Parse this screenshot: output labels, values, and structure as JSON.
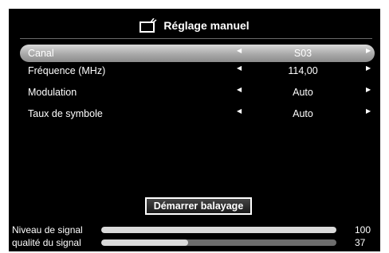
{
  "header": {
    "title": "Réglage manuel",
    "icon": "tv-antenna-icon"
  },
  "rows": [
    {
      "label": "Canal",
      "value": "S03",
      "selected": true
    },
    {
      "label": "Fréquence (MHz)",
      "value": "114,00"
    },
    {
      "label": "Modulation",
      "value": "Auto"
    },
    {
      "label": "Taux de symbole",
      "value": "Auto"
    }
  ],
  "arrows": {
    "left": "◀",
    "right": "▶"
  },
  "scan_button": {
    "label": "Démarrer balayage"
  },
  "meters": [
    {
      "label": "Niveau de signal",
      "value": "100",
      "level_percent": 100
    },
    {
      "label": "qualité du signal",
      "value": "37",
      "level_percent": 37
    }
  ],
  "colors": {
    "background": "#000000",
    "text": "#ffffff",
    "selection": "#bfbfbf"
  }
}
